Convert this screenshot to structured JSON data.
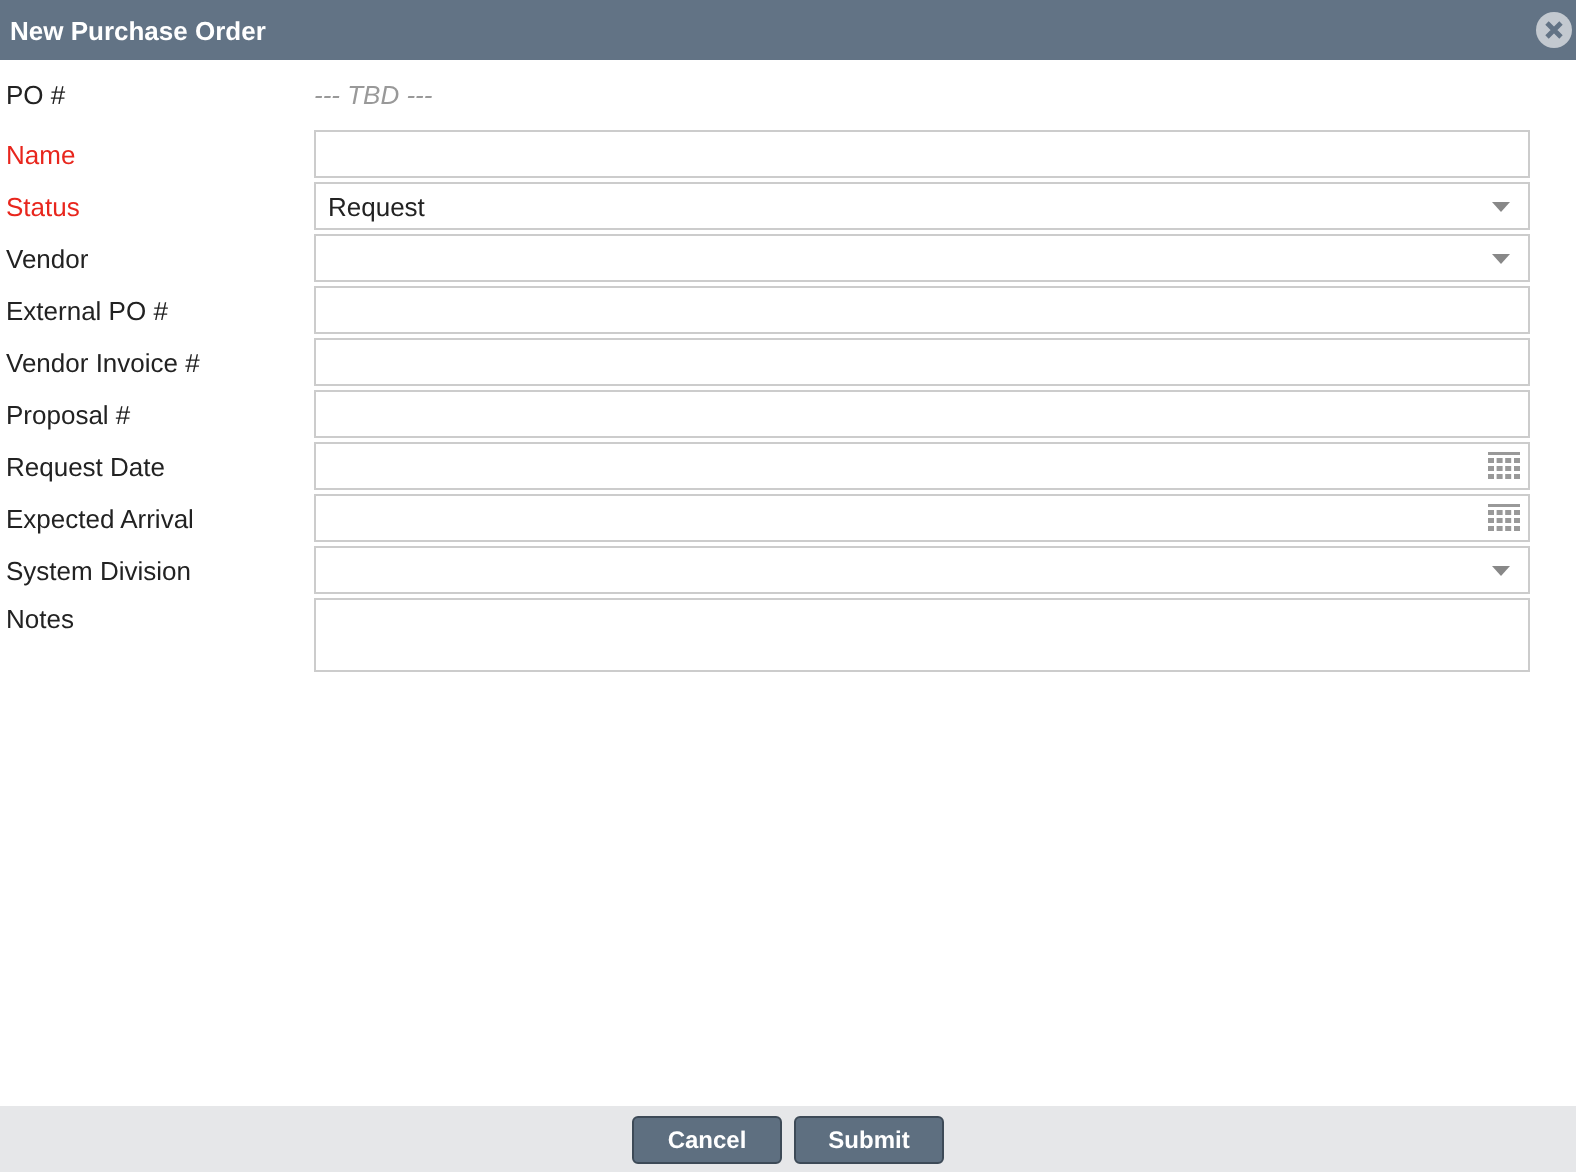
{
  "window": {
    "title": "New Purchase Order"
  },
  "po_number": {
    "label": "PO #",
    "value": "--- TBD ---"
  },
  "fields": [
    {
      "label": "Name",
      "kind": "text",
      "required": true
    },
    {
      "label": "Status",
      "kind": "select",
      "required": true,
      "value": "Request"
    },
    {
      "label": "Vendor",
      "kind": "select",
      "required": false
    },
    {
      "label": "External PO #",
      "kind": "text",
      "required": false
    },
    {
      "label": "Vendor Invoice #",
      "kind": "text",
      "required": false
    },
    {
      "label": "Proposal #",
      "kind": "text",
      "required": false
    },
    {
      "label": "Request Date",
      "kind": "date",
      "required": false
    },
    {
      "label": "Expected Arrival",
      "kind": "date",
      "required": false
    },
    {
      "label": "System Division",
      "kind": "select",
      "required": false
    },
    {
      "label": "Notes",
      "kind": "textarea",
      "required": false
    }
  ],
  "buttons": [
    "Cancel",
    "Submit"
  ]
}
